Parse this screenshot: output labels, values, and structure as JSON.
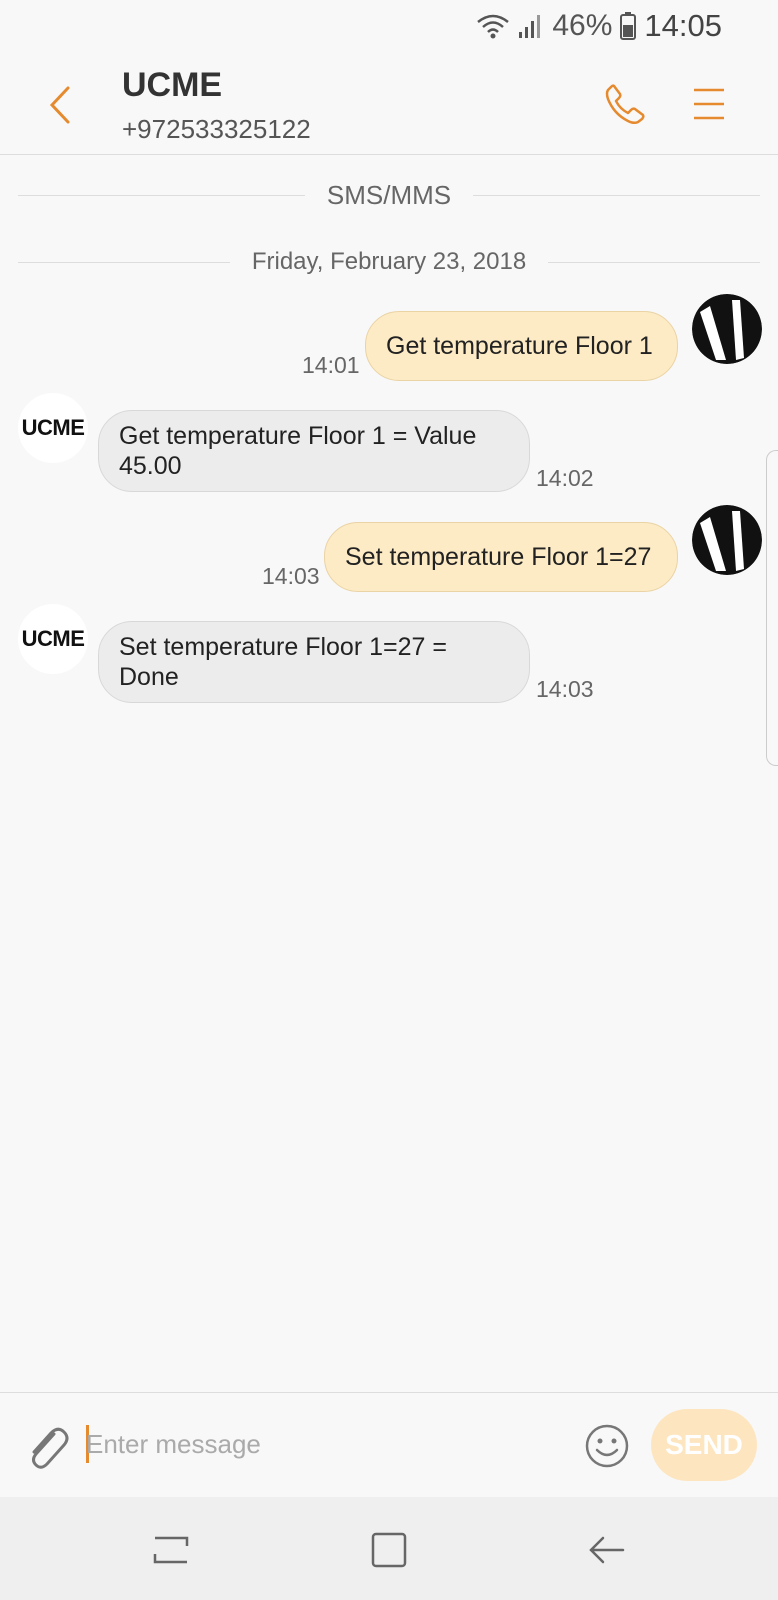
{
  "status_bar": {
    "battery": "46%",
    "time": "14:05",
    "icons": [
      "wifi-icon",
      "signal-icon",
      "battery-icon"
    ]
  },
  "header": {
    "contact_name": "UCME",
    "contact_number": "+972533325122",
    "icons": [
      "back-icon",
      "phone-icon",
      "menu-icon"
    ]
  },
  "conversation": {
    "channel_label": "SMS/MMS",
    "date_label": "Friday, February 23, 2018",
    "messages": [
      {
        "direction": "out",
        "text": "Get temperature Floor 1",
        "time": "14:01"
      },
      {
        "direction": "in",
        "sender_avatar": "UCME",
        "text": "Get temperature Floor 1 = Value 45.00",
        "time": "14:02"
      },
      {
        "direction": "out",
        "text": "Set temperature Floor 1=27",
        "time": "14:03"
      },
      {
        "direction": "in",
        "sender_avatar": "UCME",
        "text": "Set temperature Floor 1=27 = Done",
        "time": "14:03"
      }
    ]
  },
  "composer": {
    "placeholder": "Enter message",
    "value": "",
    "send_label": "SEND"
  },
  "colors": {
    "accent": "#e58a2e",
    "outgoing_bubble": "#fdebc5",
    "incoming_bubble": "#ececec",
    "send_button": "#fde5c0"
  }
}
